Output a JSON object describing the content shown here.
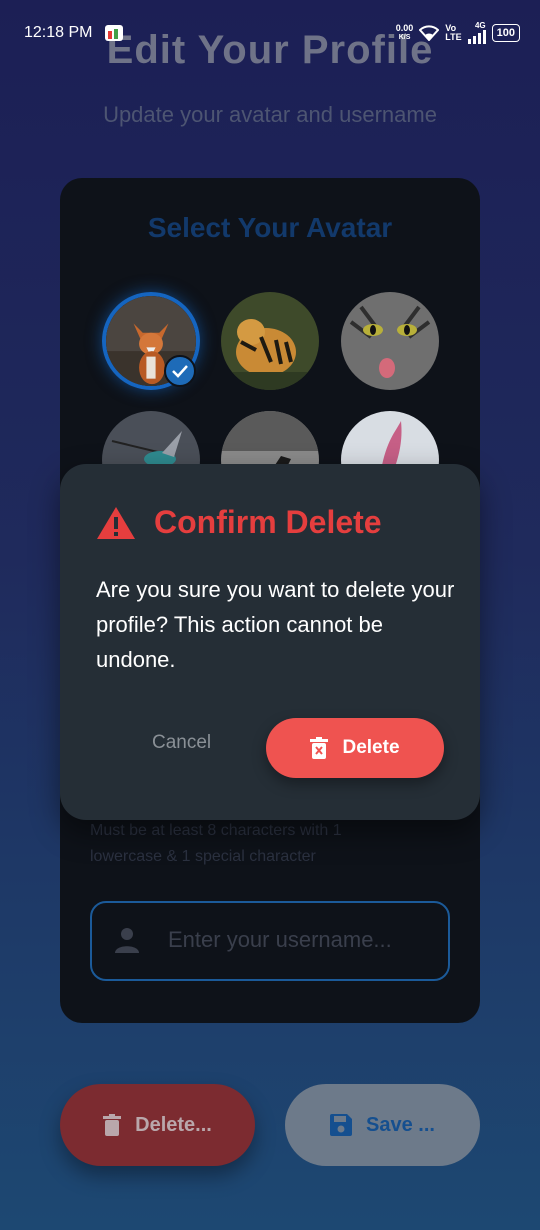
{
  "status_bar": {
    "time": "12:18 PM",
    "net_speed": "0.00",
    "net_unit": "K/S",
    "volte": "Vo",
    "lte": "LTE",
    "signal": "4G",
    "battery": "100"
  },
  "page": {
    "title": "Edit Your Profile",
    "subtitle": "Update your avatar and username",
    "card": {
      "title": "Select Your Avatar",
      "avatars": [
        {
          "name": "fox",
          "selected": true
        },
        {
          "name": "tiger",
          "selected": false
        },
        {
          "name": "cat",
          "selected": false
        },
        {
          "name": "hummingbird",
          "selected": false
        },
        {
          "name": "horse",
          "selected": false
        },
        {
          "name": "abstract-figure",
          "selected": false
        }
      ],
      "hint": "Must be at least 8 characters with 1 lowercase & 1 special character",
      "username_placeholder": "Enter your username...",
      "username_value": ""
    },
    "delete_button": "Delete...",
    "save_button": "Save ..."
  },
  "dialog": {
    "title": "Confirm Delete",
    "message": "Are you sure you want to delete your profile? This action cannot be undone.",
    "cancel_label": "Cancel",
    "delete_label": "Delete"
  },
  "colors": {
    "accent_blue": "#1565c0",
    "danger_red": "#e53e3e",
    "danger_button": "#ef5350",
    "dialog_bg": "#252e36"
  }
}
